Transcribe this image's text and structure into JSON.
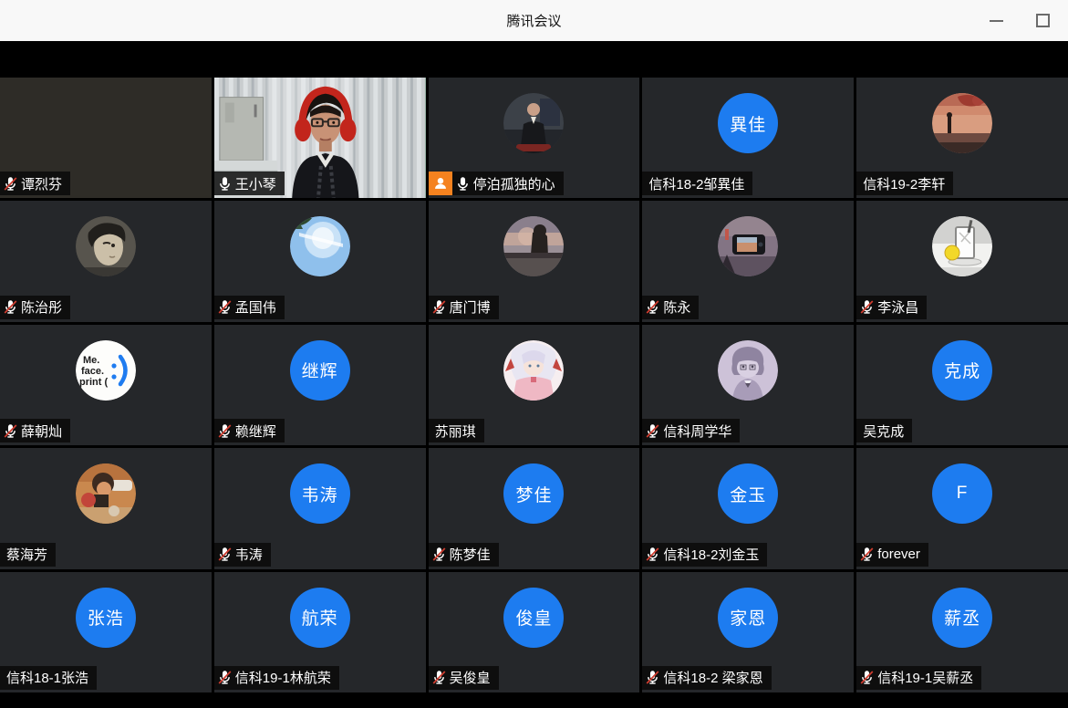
{
  "window": {
    "title": "腾讯会议",
    "controls": [
      {
        "name": "minimize"
      },
      {
        "name": "maximize"
      }
    ]
  },
  "meeting": {
    "layout": "gallery-grid",
    "grid": {
      "rows": 5,
      "cols": 5
    },
    "colors": {
      "avatar_blue": "#1d7cf0",
      "speaking_border_green": "#2ba24f",
      "badge_orange": "#f5821f",
      "mic_slash_red": "#cf3d30",
      "tile_background": "#25272a",
      "label_background": "rgba(10,10,10,0.84)",
      "titlebar_background": "#f8f8f8"
    },
    "participants": [
      {
        "name": "谭烈芬",
        "mic": "muted",
        "tile": "video_dark"
      },
      {
        "name": "王小琴",
        "mic": "on",
        "tile": "video",
        "speaking": true
      },
      {
        "name": "停泊孤独的心",
        "mic": "on",
        "badge": "person",
        "avatar": {
          "type": "photo",
          "style": "suit_photo"
        }
      },
      {
        "name": "信科18-2邹異佳",
        "mic": "none",
        "avatar": {
          "type": "initials",
          "text": "異佳"
        }
      },
      {
        "name": "信科19-2李轩",
        "mic": "none",
        "avatar": {
          "type": "photo",
          "style": "sunset_tree"
        }
      },
      {
        "name": "陈治彤",
        "mic": "muted",
        "avatar": {
          "type": "photo",
          "style": "manga_face"
        }
      },
      {
        "name": "孟国伟",
        "mic": "muted",
        "avatar": {
          "type": "photo",
          "style": "sky"
        }
      },
      {
        "name": "唐门博",
        "mic": "muted",
        "avatar": {
          "type": "photo",
          "style": "sunset_silhouette"
        }
      },
      {
        "name": "陈永",
        "mic": "muted",
        "avatar": {
          "type": "photo",
          "style": "phone_sunset"
        }
      },
      {
        "name": "李泳昌",
        "mic": "muted",
        "avatar": {
          "type": "photo",
          "style": "popart_drink"
        }
      },
      {
        "name": "薛朝灿",
        "mic": "muted",
        "avatar": {
          "type": "photo",
          "style": "me_face_print"
        }
      },
      {
        "name": "赖继辉",
        "mic": "muted",
        "avatar": {
          "type": "initials",
          "text": "继辉"
        }
      },
      {
        "name": "苏丽琪",
        "mic": "none",
        "avatar": {
          "type": "photo",
          "style": "anime_girl"
        }
      },
      {
        "name": "信科周学华",
        "mic": "muted",
        "avatar": {
          "type": "photo",
          "style": "anime_boy"
        }
      },
      {
        "name": "吴克成",
        "mic": "none",
        "avatar": {
          "type": "initials",
          "text": "克成"
        }
      },
      {
        "name": "蔡海芳",
        "mic": "none",
        "avatar": {
          "type": "photo",
          "style": "child_photo"
        }
      },
      {
        "name": "韦涛",
        "mic": "muted",
        "avatar": {
          "type": "initials",
          "text": "韦涛"
        }
      },
      {
        "name": "陈梦佳",
        "mic": "muted",
        "avatar": {
          "type": "initials",
          "text": "梦佳"
        }
      },
      {
        "name": "信科18-2刘金玉",
        "mic": "muted",
        "avatar": {
          "type": "initials",
          "text": "金玉"
        }
      },
      {
        "name": "forever",
        "mic": "muted",
        "avatar": {
          "type": "initials",
          "text": "F"
        }
      },
      {
        "name": "信科18-1张浩",
        "mic": "none",
        "avatar": {
          "type": "initials",
          "text": "张浩"
        }
      },
      {
        "name": "信科19-1林航荣",
        "mic": "muted",
        "avatar": {
          "type": "initials",
          "text": "航荣"
        }
      },
      {
        "name": "吴俊皇",
        "mic": "muted",
        "avatar": {
          "type": "initials",
          "text": "俊皇"
        }
      },
      {
        "name": "信科18-2 梁家恩",
        "mic": "muted",
        "avatar": {
          "type": "initials",
          "text": "家恩"
        }
      },
      {
        "name": "信科19-1吴薪丞",
        "mic": "muted",
        "avatar": {
          "type": "initials",
          "text": "薪丞"
        }
      }
    ]
  }
}
